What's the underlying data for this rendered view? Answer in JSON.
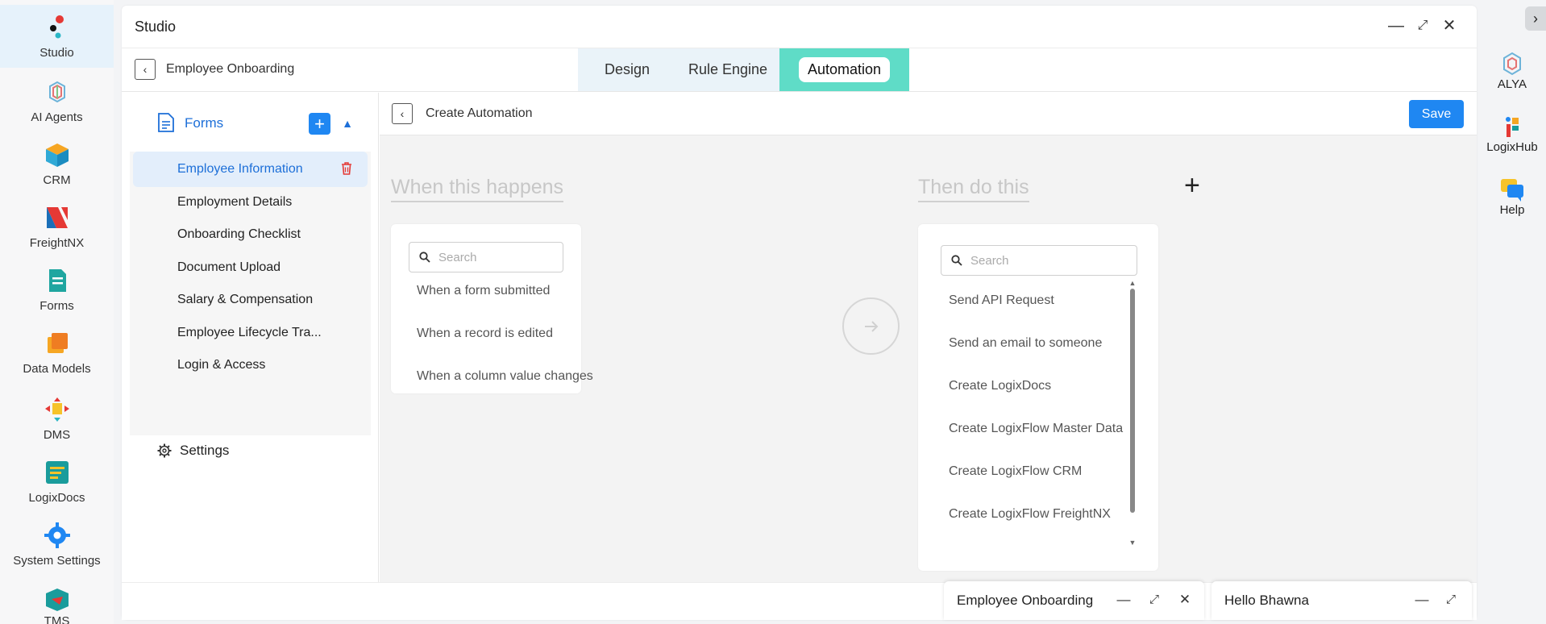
{
  "left_rail": [
    {
      "label": "Studio",
      "icon": "studio-icon",
      "active": true
    },
    {
      "label": "AI Agents",
      "icon": "ai-agents-icon"
    },
    {
      "label": "CRM",
      "icon": "crm-icon"
    },
    {
      "label": "FreightNX",
      "icon": "freightnx-icon"
    },
    {
      "label": "Forms",
      "icon": "forms-icon"
    },
    {
      "label": "Data Models",
      "icon": "data-models-icon"
    },
    {
      "label": "DMS",
      "icon": "dms-icon"
    },
    {
      "label": "LogixDocs",
      "icon": "logixdocs-icon"
    },
    {
      "label": "System Settings",
      "icon": "system-settings-icon"
    },
    {
      "label": "TMS",
      "icon": "tms-icon"
    }
  ],
  "right_rail": [
    {
      "label": "ALYA",
      "icon": "alya-icon"
    },
    {
      "label": "LogixHub",
      "icon": "logixhub-icon"
    },
    {
      "label": "Help",
      "icon": "help-icon"
    }
  ],
  "window": {
    "title": "Studio"
  },
  "subbar": {
    "app_name": "Employee Onboarding",
    "tabs": [
      {
        "label": "Design"
      },
      {
        "label": "Rule Engine"
      },
      {
        "label": "Automation",
        "active": true
      }
    ]
  },
  "forms_pane": {
    "heading": "Forms",
    "items": [
      {
        "label": "Employee Information",
        "selected": true
      },
      {
        "label": "Employment Details"
      },
      {
        "label": "Onboarding Checklist"
      },
      {
        "label": "Document Upload"
      },
      {
        "label": "Salary & Compensation"
      },
      {
        "label": "Employee Lifecycle Tra..."
      },
      {
        "label": "Login & Access"
      }
    ],
    "settings_label": "Settings"
  },
  "canvas": {
    "title": "Create Automation",
    "save_label": "Save",
    "trigger": {
      "heading": "When this happens",
      "search_placeholder": "Search",
      "options": [
        "When a form submitted",
        "When a record is edited",
        "When a column value changes"
      ]
    },
    "action": {
      "heading": "Then do this",
      "search_placeholder": "Search",
      "options": [
        "Send API Request",
        "Send an email to someone",
        "Create LogixDocs",
        "Create LogixFlow Master Data",
        "Create LogixFlow CRM",
        "Create LogixFlow FreightNX"
      ]
    }
  },
  "minimized_windows": [
    {
      "title": "Employee Onboarding"
    },
    {
      "title": "Hello Bhawna"
    }
  ],
  "colors": {
    "accent": "#1f87f2",
    "tab_active": "#5fdcc7",
    "selected_bg": "#e3eefb"
  }
}
